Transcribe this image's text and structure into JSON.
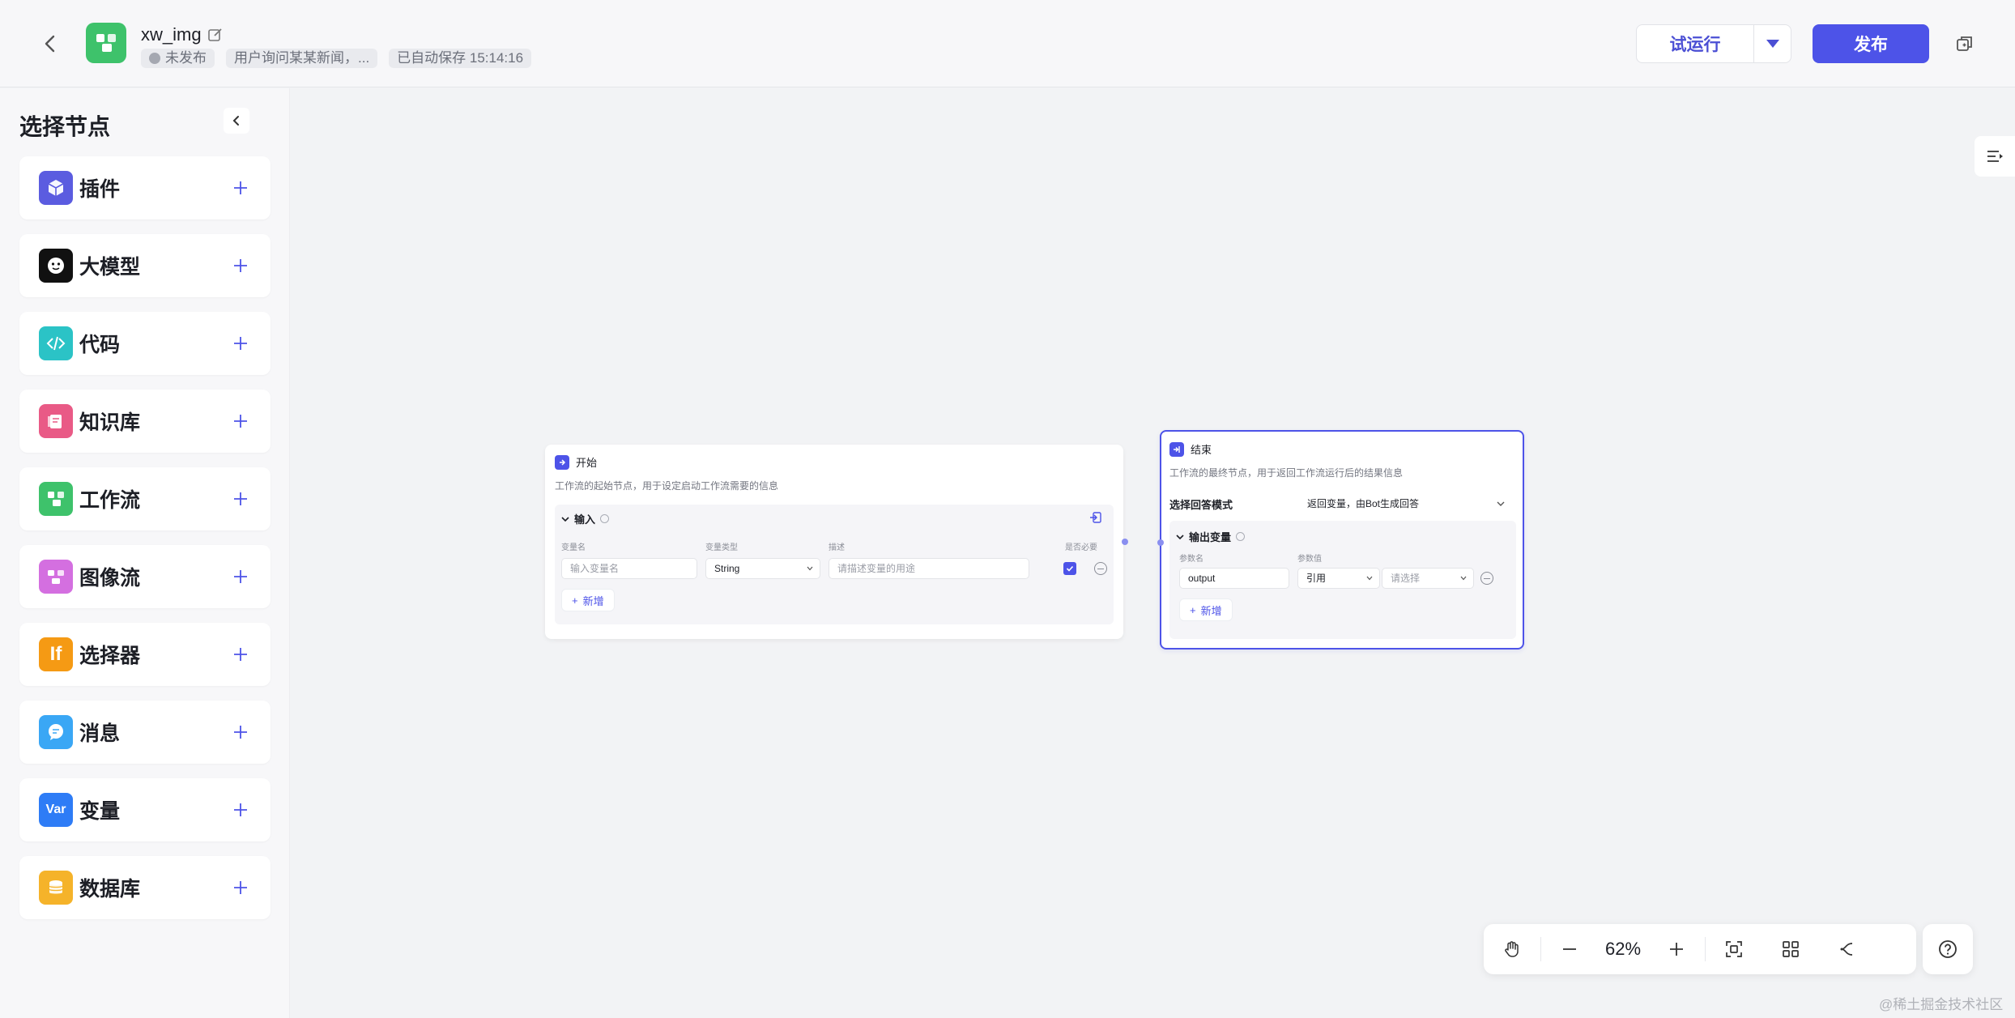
{
  "header": {
    "app_name": "xw_img",
    "status": "未发布",
    "description": "用户询问某某新闻，...",
    "autosave": "已自动保存 15:14:16",
    "run_label": "试运行",
    "publish_label": "发布"
  },
  "sidebar": {
    "title": "选择节点",
    "items": [
      {
        "label": "插件",
        "icon": "cube-icon",
        "color": "#5b5ce0"
      },
      {
        "label": "大模型",
        "icon": "llm-face-icon",
        "color": "#111111"
      },
      {
        "label": "代码",
        "icon": "code-icon",
        "color": "#2bc3c6"
      },
      {
        "label": "知识库",
        "icon": "knowledge-icon",
        "color": "#e95a86"
      },
      {
        "label": "工作流",
        "icon": "workflow-icon",
        "color": "#3ec26b"
      },
      {
        "label": "图像流",
        "icon": "imageflow-icon",
        "color": "#d46fe0"
      },
      {
        "label": "选择器",
        "icon": "if-icon",
        "icon_text": "If",
        "color": "#f59a14"
      },
      {
        "label": "消息",
        "icon": "message-icon",
        "color": "#3aa7f5"
      },
      {
        "label": "变量",
        "icon": "var-icon",
        "icon_text": "Var",
        "color": "#2e7cf6"
      },
      {
        "label": "数据库",
        "icon": "database-icon",
        "color": "#f5b32a"
      }
    ]
  },
  "start_node": {
    "title": "开始",
    "description": "工作流的起始节点，用于设定启动工作流需要的信息",
    "section": "输入",
    "col_name": "变量名",
    "col_type": "变量类型",
    "col_desc": "描述",
    "col_required": "是否必要",
    "name_placeholder": "输入变量名",
    "type_value": "String",
    "desc_placeholder": "请描述变量的用途",
    "add_label": "新增"
  },
  "end_node": {
    "title": "结束",
    "description": "工作流的最终节点，用于返回工作流运行后的结果信息",
    "mode_label": "选择回答模式",
    "mode_value": "返回变量，由Bot生成回答",
    "section": "输出变量",
    "col_name": "参数名",
    "col_value": "参数值",
    "param_name": "output",
    "ref_value": "引用",
    "select_placeholder": "请选择",
    "add_label": "新增"
  },
  "toolbar": {
    "zoom": "62%"
  },
  "watermark": "@稀土掘金技术社区"
}
